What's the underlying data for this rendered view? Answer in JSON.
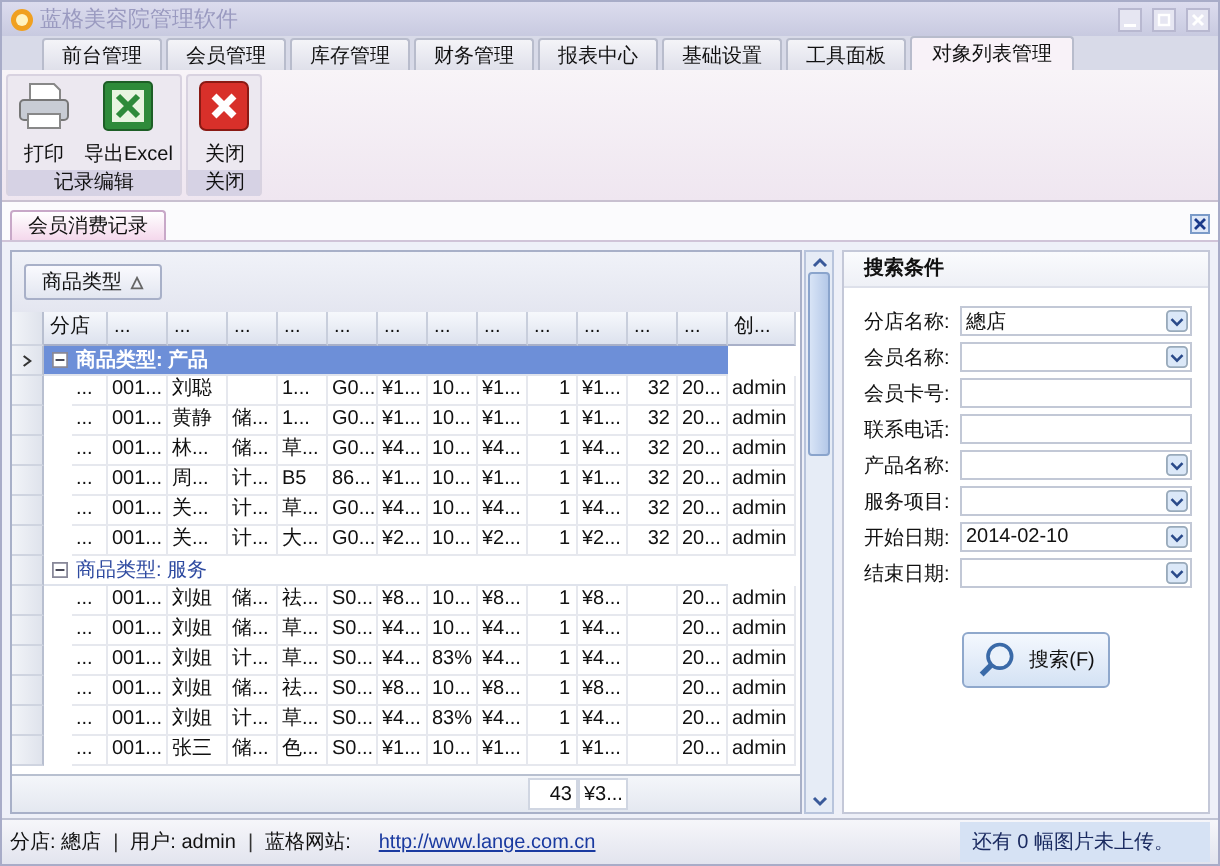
{
  "window": {
    "title": "蓝格美容院管理软件"
  },
  "tabs": [
    {
      "label": "前台管理",
      "selected": false
    },
    {
      "label": "会员管理",
      "selected": false
    },
    {
      "label": "库存管理",
      "selected": false
    },
    {
      "label": "财务管理",
      "selected": false
    },
    {
      "label": "报表中心",
      "selected": false
    },
    {
      "label": "基础设置",
      "selected": false
    },
    {
      "label": "工具面板",
      "selected": false
    },
    {
      "label": "对象列表管理",
      "selected": true
    }
  ],
  "ribbon": {
    "groups": [
      {
        "label": "记录编辑",
        "buttons": [
          {
            "label": "打印"
          },
          {
            "label": "导出Excel"
          }
        ]
      },
      {
        "label": "关闭",
        "buttons": [
          {
            "label": "关闭"
          }
        ]
      }
    ]
  },
  "doc_tabs": [
    {
      "label": "会员消费记录",
      "selected": true
    }
  ],
  "group_by": {
    "label": "商品类型"
  },
  "table": {
    "columns": [
      "分店",
      "...",
      "...",
      "...",
      "...",
      "...",
      "...",
      "...",
      "...",
      "...",
      "...",
      "...",
      "...",
      "创..."
    ],
    "groups": [
      {
        "label": "商品类型: 产品",
        "selected": true,
        "expanded": true,
        "rows": [
          [
            "...",
            "001...",
            "刘聪",
            null,
            "1...",
            "G0...",
            "¥1...",
            "10...",
            "¥1...",
            "1",
            "¥1...",
            "32",
            "20...",
            "admin"
          ],
          [
            "...",
            "001...",
            "黄静",
            "储...",
            "1...",
            "G0...",
            "¥1...",
            "10...",
            "¥1...",
            "1",
            "¥1...",
            "32",
            "20...",
            "admin"
          ],
          [
            "...",
            "001...",
            "林...",
            "储...",
            "草...",
            "G0...",
            "¥4...",
            "10...",
            "¥4...",
            "1",
            "¥4...",
            "32",
            "20...",
            "admin"
          ],
          [
            "...",
            "001...",
            "周...",
            "计...",
            "B5",
            "86...",
            "¥1...",
            "10...",
            "¥1...",
            "1",
            "¥1...",
            "32",
            "20...",
            "admin"
          ],
          [
            "...",
            "001...",
            "关...",
            "计...",
            "草...",
            "G0...",
            "¥4...",
            "10...",
            "¥4...",
            "1",
            "¥4...",
            "32",
            "20...",
            "admin"
          ],
          [
            "...",
            "001...",
            "关...",
            "计...",
            "大...",
            "G0...",
            "¥2...",
            "10...",
            "¥2...",
            "1",
            "¥2...",
            "32",
            "20...",
            "admin"
          ]
        ]
      },
      {
        "label": "商品类型: 服务",
        "selected": false,
        "expanded": true,
        "rows": [
          [
            "...",
            "001...",
            "刘姐",
            "储...",
            "祛...",
            "S0...",
            "¥8...",
            "10...",
            "¥8...",
            "1",
            "¥8...",
            null,
            "20...",
            "admin"
          ],
          [
            "...",
            "001...",
            "刘姐",
            "储...",
            "草...",
            "S0...",
            "¥4...",
            "10...",
            "¥4...",
            "1",
            "¥4...",
            null,
            "20...",
            "admin"
          ],
          [
            "...",
            "001...",
            "刘姐",
            "计...",
            "草...",
            "S0...",
            "¥4...",
            "83%",
            "¥4...",
            "1",
            "¥4...",
            null,
            "20...",
            "admin"
          ],
          [
            "...",
            "001...",
            "刘姐",
            "储...",
            "祛...",
            "S0...",
            "¥8...",
            "10...",
            "¥8...",
            "1",
            "¥8...",
            null,
            "20...",
            "admin"
          ],
          [
            "...",
            "001...",
            "刘姐",
            "计...",
            "草...",
            "S0...",
            "¥4...",
            "83%",
            "¥4...",
            "1",
            "¥4...",
            null,
            "20...",
            "admin"
          ],
          [
            "...",
            "001...",
            "张三",
            "储...",
            "色...",
            "S0...",
            "¥1...",
            "10...",
            "¥1...",
            "1",
            "¥1...",
            null,
            "20...",
            "admin"
          ]
        ]
      }
    ],
    "summary": {
      "count": "43",
      "amount": "¥3..."
    }
  },
  "search": {
    "title": "搜索条件",
    "fields": [
      {
        "label": "分店名称:",
        "kind": "combo",
        "value": "總店"
      },
      {
        "label": "会员名称:",
        "kind": "combo"
      },
      {
        "label": "会员卡号:",
        "kind": "text"
      },
      {
        "label": "联系电话:",
        "kind": "text"
      },
      {
        "label": "产品名称:",
        "kind": "combo"
      },
      {
        "label": "服务项目:",
        "kind": "combo"
      },
      {
        "label": "开始日期:",
        "kind": "combo",
        "value": "2014-02-10"
      },
      {
        "label": "结束日期:",
        "kind": "combo"
      }
    ],
    "button": "搜索(F)"
  },
  "status_bar": {
    "items": [
      {
        "kind": "text",
        "text": "分店: 總店"
      },
      {
        "kind": "sep",
        "text": "|"
      },
      {
        "kind": "text",
        "text": "用户: admin"
      },
      {
        "kind": "sep",
        "text": "|"
      },
      {
        "kind": "text",
        "text": "蓝格网站:"
      },
      {
        "kind": "link",
        "text": "http://www.lange.com.cn"
      }
    ],
    "message": "还有 0 幅图片未上传。"
  }
}
